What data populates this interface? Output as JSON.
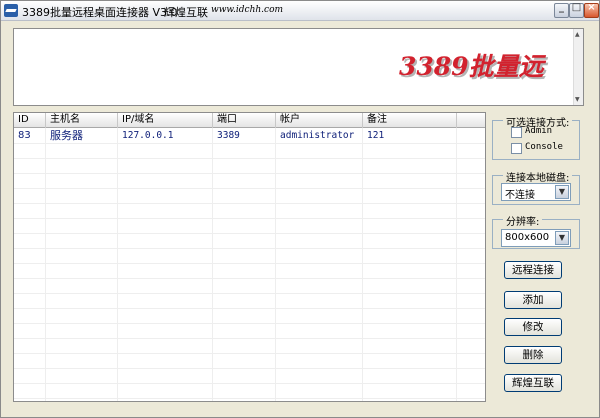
{
  "window": {
    "title": "3389批量远程桌面连接器 V3.0",
    "brand": "辉煌互联",
    "url": "www.idchh.com"
  },
  "banner": {
    "text": "3389批量远"
  },
  "table": {
    "columns": [
      "ID",
      "主机名",
      "IP/域名",
      "端口",
      "帐户",
      "备注"
    ],
    "rows": [
      {
        "id": "83",
        "host": "服务器",
        "ip": "127.0.0.1",
        "port": "3389",
        "account": "administrator",
        "note": "121"
      }
    ]
  },
  "connect_mode": {
    "title": "可选连接方式:",
    "options": [
      {
        "label": "Admin",
        "checked": false
      },
      {
        "label": "Console",
        "checked": false
      }
    ]
  },
  "local_disk": {
    "title": "连接本地磁盘:",
    "value": "不连接"
  },
  "resolution": {
    "title": "分辨率:",
    "value": "800x600"
  },
  "buttons": {
    "remote_connect": "远程连接",
    "add": "添加",
    "edit": "修改",
    "delete": "删除",
    "brand": "辉煌互联"
  }
}
